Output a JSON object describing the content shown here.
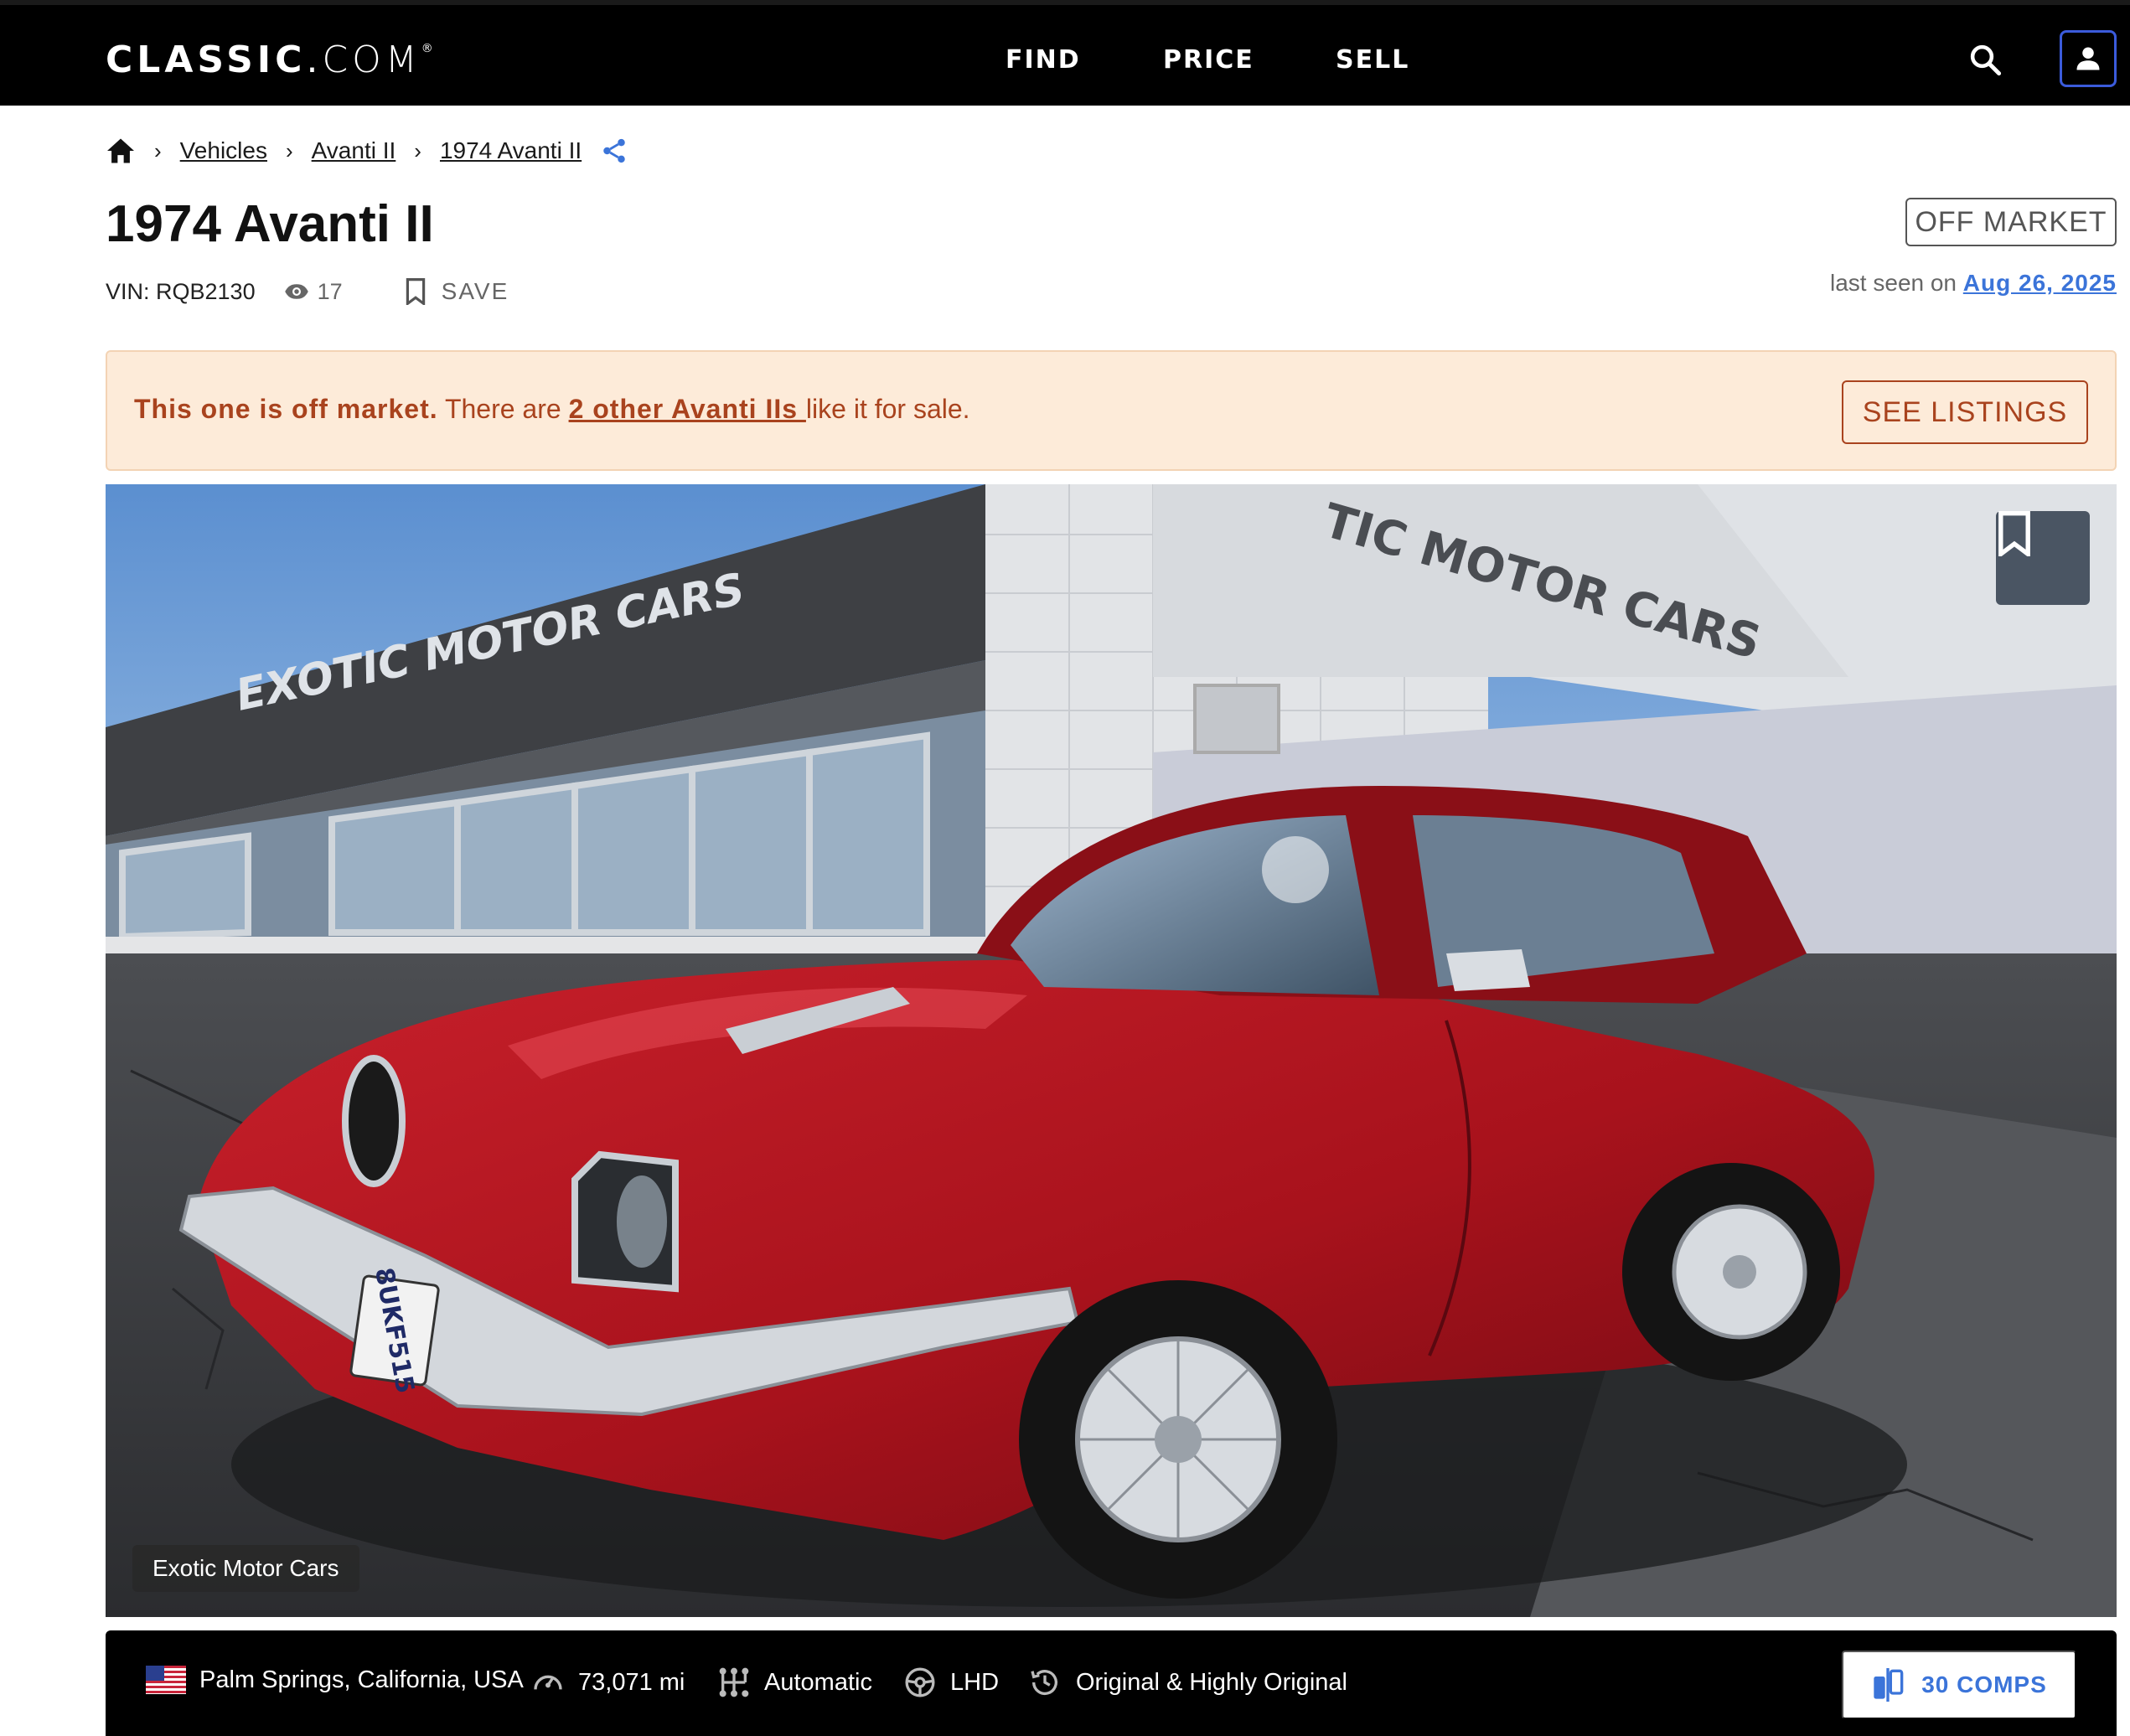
{
  "header": {
    "logo_classic": "CLASSIC",
    "logo_dot": ".",
    "logo_com": "COM",
    "nav": [
      "FIND",
      "PRICE",
      "SELL"
    ]
  },
  "breadcrumb": {
    "items": [
      "Vehicles",
      "Avanti II",
      "1974 Avanti II"
    ]
  },
  "listing": {
    "title": "1974 Avanti II",
    "vin": "VIN: RQB2130",
    "views": "17",
    "save_label": "SAVE",
    "status": "OFF MARKET",
    "last_seen_prefix": "last seen on ",
    "last_seen_date": "Aug 26, 2025"
  },
  "banner": {
    "bold": "This one is off market.",
    "prefix": " There are ",
    "link": "2 other Avanti IIs ",
    "suffix": "like it for sale.",
    "button": "SEE LISTINGS"
  },
  "hero": {
    "dealer": "Exotic Motor Cars",
    "sign_text_left": "EXOTIC MOTOR CARS",
    "sign_text_right": "TIC MOTOR CARS",
    "plate": "8UKF515"
  },
  "specs": {
    "location": "Palm Springs, California, USA",
    "mileage": "73,071 mi",
    "transmission": "Automatic",
    "drive_side": "LHD",
    "originality": "Original & Highly Original",
    "comps_button": "30 COMPS"
  },
  "colors": {
    "header_bg": "#000000",
    "banner_bg": "#fdebd9",
    "banner_text": "#a9431e",
    "link_blue": "#3b74d9",
    "car_red": "#a8121c"
  }
}
